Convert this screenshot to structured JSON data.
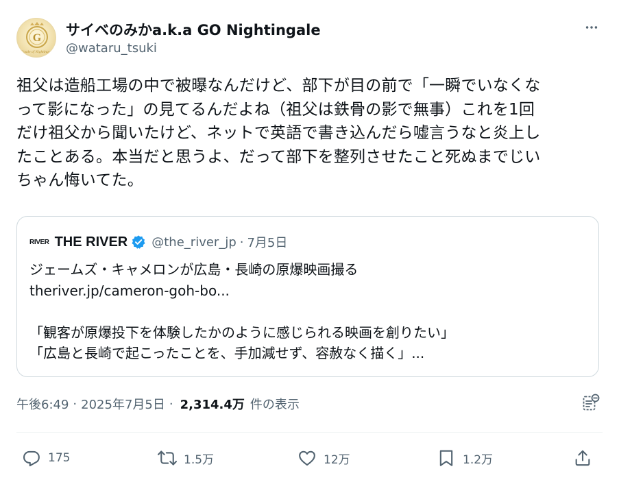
{
  "author": {
    "display_name": "サイベのみかa.k.a GO Nightingale",
    "handle": "@wataru_tsuki",
    "avatar_icon": "nightingale-logo-avatar",
    "avatar_text": "Castle of Nightingale"
  },
  "tweet": {
    "text": "祖父は造船工場の中で被曝なんだけど、部下が目の前で「一瞬でいなくな\nって影になった」の見てるんだよね（祖父は鉄骨の影で無事）これを1回\nだけ祖父から聞いたけど、ネットで英語で書き込んだら嘘言うなと炎上し\nたことある。本当だと思うよ、だって部下を整列させたこと死ぬまでじい\nちゃん悔いてた。"
  },
  "quote": {
    "logo_text": "RIVER",
    "display_name": "THE RIVER",
    "verified_icon": "verified-badge-icon",
    "handle": "@the_river_jp",
    "separator": "·",
    "date": "7月5日",
    "body": "ジェームズ・キャメロンが広島・長崎の原爆映画撮る\ntheriver.jp/cameron-goh-bo...\n\n「観客が原爆投下を体験したかのように感じられる映画を創りたい」\n「広島と長崎で起こったことを、手加減せず、容赦なく描く」..."
  },
  "meta": {
    "time": "午後6:49",
    "separator": "·",
    "date": "2025年7月5日",
    "views": "2,314.4万",
    "views_label": "件の表示"
  },
  "actions": {
    "reply_count": "175",
    "retweet_count": "1.5万",
    "like_count": "12万",
    "bookmark_count": "1.2万"
  },
  "colors": {
    "text": "#0f1419",
    "muted": "#536471",
    "border": "#cfd9de",
    "verified": "#1d9bf0"
  }
}
